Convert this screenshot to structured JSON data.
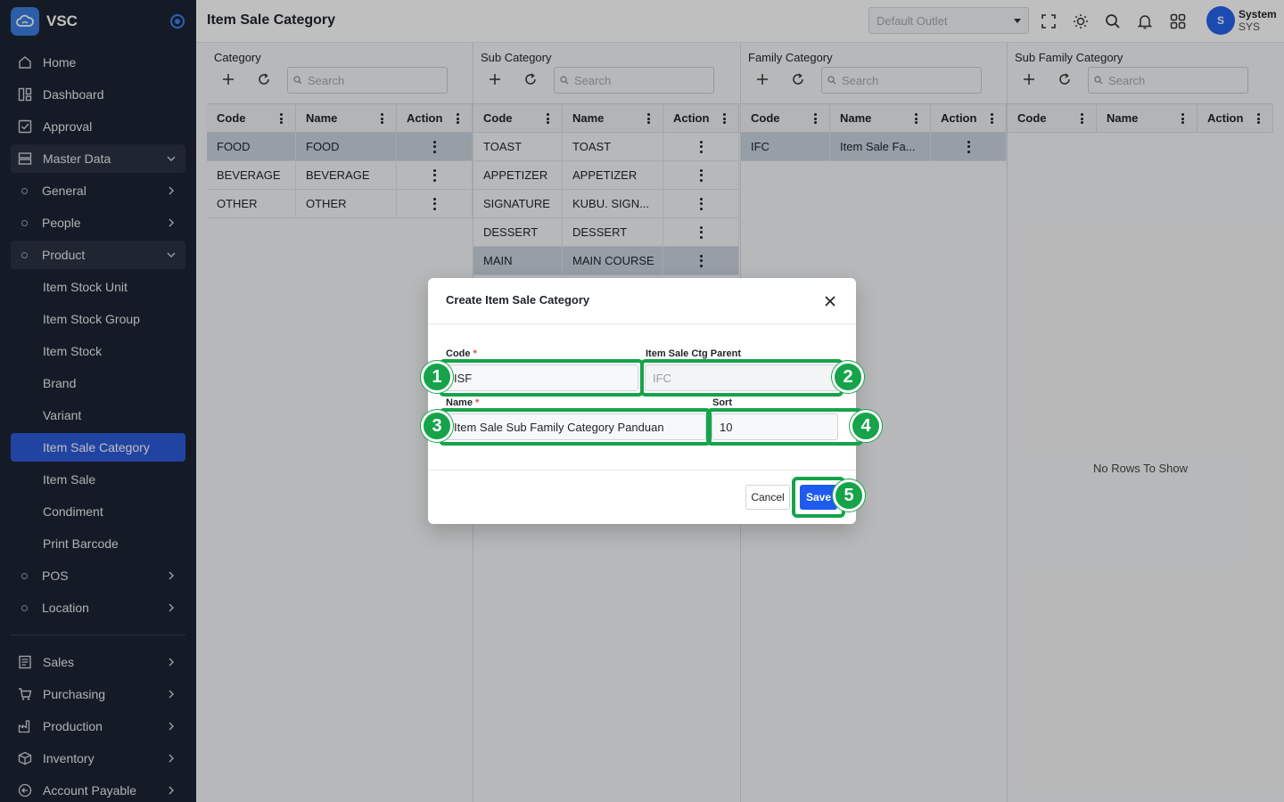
{
  "app": {
    "brand_name": "VSC",
    "page_title": "Item Sale Category",
    "colors": {
      "sidebar_bg": "#1d2433",
      "accent": "#2d5bd8",
      "highlight": "#16a34a"
    }
  },
  "topbar": {
    "outlet_placeholder": "Default Outlet",
    "user_initial": "S",
    "user_name": "System",
    "user_role": "SYS",
    "icons": [
      "fullscreen-icon",
      "theme-sun-icon",
      "search-icon",
      "bell-icon",
      "apps-grid-icon"
    ]
  },
  "sidebar": {
    "items": [
      {
        "label": "Home"
      },
      {
        "label": "Dashboard"
      },
      {
        "label": "Approval"
      },
      {
        "label": "Master Data"
      },
      {
        "label": "General"
      },
      {
        "label": "People"
      },
      {
        "label": "Product"
      },
      {
        "label": "Item Stock Unit"
      },
      {
        "label": "Item Stock Group"
      },
      {
        "label": "Item Stock"
      },
      {
        "label": "Brand"
      },
      {
        "label": "Variant"
      },
      {
        "label": "Item Sale Category"
      },
      {
        "label": "Item Sale"
      },
      {
        "label": "Condiment"
      },
      {
        "label": "Print Barcode"
      },
      {
        "label": "POS"
      },
      {
        "label": "Location"
      },
      {
        "label": "Sales"
      },
      {
        "label": "Purchasing"
      },
      {
        "label": "Production"
      },
      {
        "label": "Inventory"
      },
      {
        "label": "Account Payable"
      }
    ]
  },
  "grid_headers": {
    "code": "Code",
    "name": "Name",
    "action": "Action"
  },
  "search_placeholder": "Search",
  "panels": [
    {
      "title": "Category",
      "rows": [
        {
          "code": "FOOD",
          "name": "FOOD"
        },
        {
          "code": "BEVERAGE",
          "name": "BEVERAGE"
        },
        {
          "code": "OTHER",
          "name": "OTHER"
        }
      ]
    },
    {
      "title": "Sub Category",
      "rows": [
        {
          "code": "TOAST",
          "name": "TOAST"
        },
        {
          "code": "APPETIZER",
          "name": "APPETIZER"
        },
        {
          "code": "SIGNATURE",
          "name": "KUBU. SIGN..."
        },
        {
          "code": "DESSERT",
          "name": "DESSERT"
        },
        {
          "code": "MAIN",
          "name": "MAIN COURSE"
        }
      ]
    },
    {
      "title": "Family Category",
      "rows": [
        {
          "code": "IFC",
          "name": "Item Sale Fa..."
        }
      ]
    },
    {
      "title": "Sub Family Category",
      "rows": [],
      "empty_text": "No Rows To Show"
    }
  ],
  "modal": {
    "title": "Create Item Sale Category",
    "code_label": "Code",
    "code_value": "ISF",
    "parent_label": "Item Sale Ctg Parent",
    "parent_value": "IFC",
    "name_label": "Name",
    "name_value": "Item Sale Sub Family Category Panduan",
    "sort_label": "Sort",
    "sort_value": "10",
    "required_mark": "*",
    "cancel_label": "Cancel",
    "save_label": "Save"
  },
  "annotations": [
    "1",
    "2",
    "3",
    "4",
    "5"
  ]
}
